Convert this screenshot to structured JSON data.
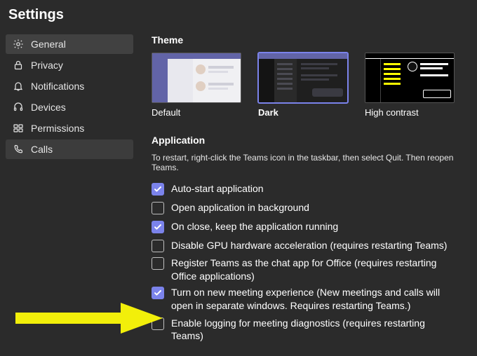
{
  "title": "Settings",
  "sidebar": {
    "items": [
      {
        "icon": "gear-icon",
        "label": "General",
        "selected": true
      },
      {
        "icon": "lock-icon",
        "label": "Privacy"
      },
      {
        "icon": "bell-icon",
        "label": "Notifications"
      },
      {
        "icon": "headset-icon",
        "label": "Devices"
      },
      {
        "icon": "permissions-icon",
        "label": "Permissions"
      },
      {
        "icon": "phone-icon",
        "label": "Calls",
        "hover": true
      }
    ]
  },
  "theme": {
    "section_label": "Theme",
    "options": [
      {
        "label": "Default",
        "kind": "default"
      },
      {
        "label": "Dark",
        "kind": "dark",
        "selected": true
      },
      {
        "label": "High contrast",
        "kind": "hc"
      }
    ]
  },
  "application": {
    "section_label": "Application",
    "help_text": "To restart, right-click the Teams icon in the taskbar, then select Quit. Then reopen Teams.",
    "options": [
      {
        "label": "Auto-start application",
        "checked": true
      },
      {
        "label": "Open application in background",
        "checked": false
      },
      {
        "label": "On close, keep the application running",
        "checked": true
      },
      {
        "label": "Disable GPU hardware acceleration (requires restarting Teams)",
        "checked": false
      },
      {
        "label": "Register Teams as the chat app for Office (requires restarting Office applications)",
        "checked": false
      },
      {
        "label": "Turn on new meeting experience (New meetings and calls will open in separate windows. Requires restarting Teams.)",
        "checked": true
      },
      {
        "label": "Enable logging for meeting diagnostics (requires restarting Teams)",
        "checked": false
      }
    ]
  }
}
